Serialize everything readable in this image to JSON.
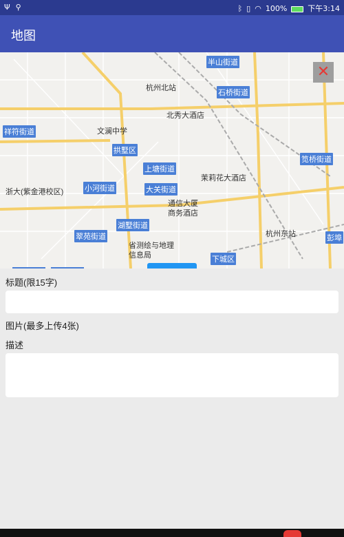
{
  "status_bar": {
    "left_icons": [
      "usb-icon",
      "usb-debug-icon"
    ],
    "battery": "100%",
    "time": "下午3:14"
  },
  "app_bar": {
    "title": "地图"
  },
  "map": {
    "labels_blue": [
      "半山街道",
      "石桥街道",
      "祥符街道",
      "拱墅区",
      "上塘街道",
      "笕桥街道",
      "小河街道",
      "大关街道",
      "湖墅街道",
      "翠苑街道",
      "下城区",
      "彭埠"
    ],
    "labels_poi": [
      "杭州北站",
      "北秀大酒店",
      "文澜中学",
      "茉莉花大酒店",
      "浙大(紫金港校区)",
      "通信大厦",
      "商务酒店",
      "省测绘与地理",
      "信息局",
      "杭州东站"
    ],
    "close_icon": "close-icon"
  },
  "form": {
    "title_label": "标题(限15字)",
    "title_value": "",
    "images_label": "图片(最多上传4张)",
    "description_label": "描述",
    "description_value": ""
  }
}
